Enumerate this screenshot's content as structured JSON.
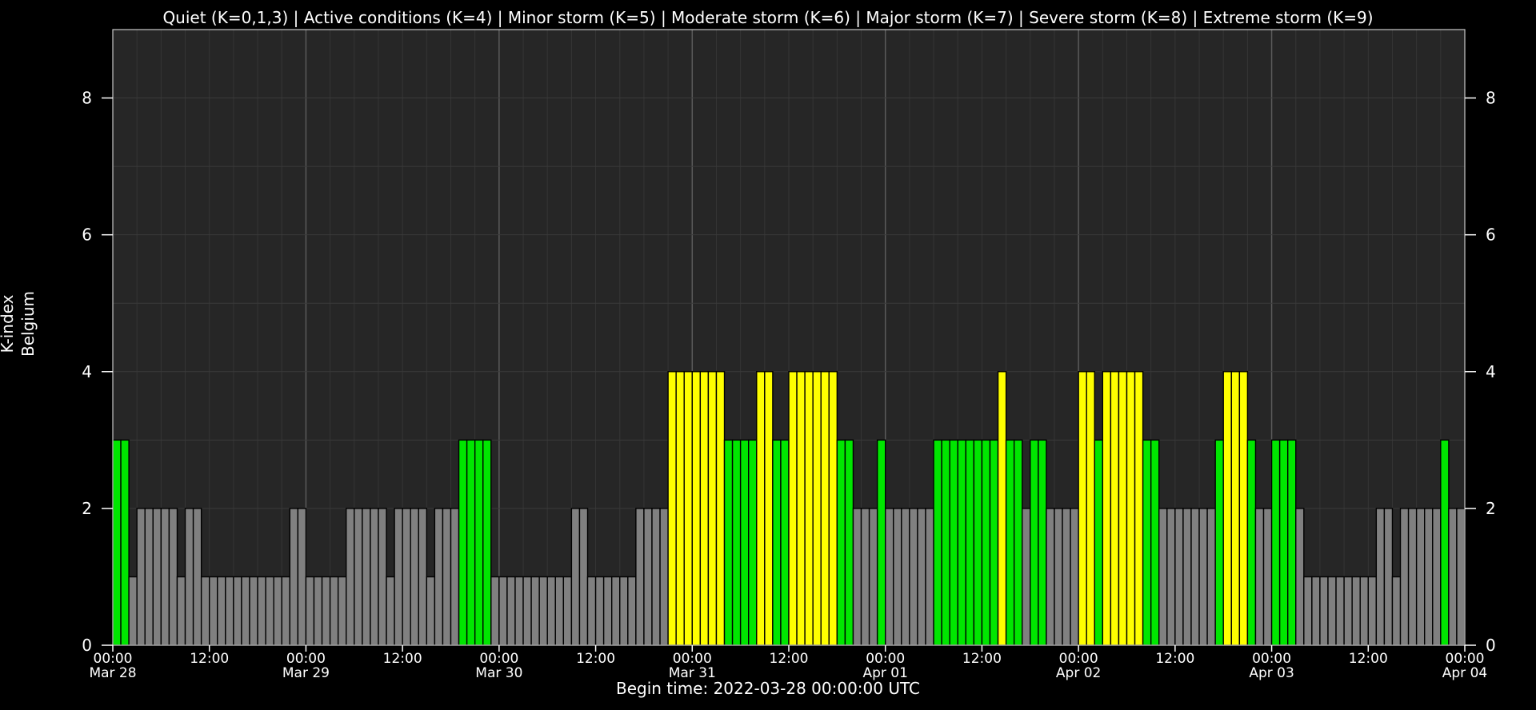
{
  "header": {
    "legend_line": "Quiet (K=0,1,3) | Active conditions (K=4) | Minor storm (K=5) | Moderate storm (K=6) | Major storm (K=7) | Severe storm (K=8) | Extreme storm (K=9)"
  },
  "footer": {
    "begin_time": "Begin time: 2022-03-28 00:00:00 UTC"
  },
  "colors": {
    "background": "#000000",
    "plot_area": "#262626",
    "k_0_2": "#808080",
    "k_3": "#00e600",
    "k_4": "#ffff00"
  },
  "chart_data": {
    "type": "bar",
    "ylabel_lines": [
      "K-index",
      "Belgium"
    ],
    "ylim": [
      0,
      9
    ],
    "yticks": [
      0,
      2,
      4,
      6,
      8
    ],
    "grid": true,
    "x_start": "2022-03-28 00:00",
    "x_end": "2022-04-04 00:00",
    "bar_interval_hours": 1,
    "xticks": [
      {
        "time": "00:00",
        "date": "Mar 28"
      },
      {
        "time": "12:00",
        "date": ""
      },
      {
        "time": "00:00",
        "date": "Mar 29"
      },
      {
        "time": "12:00",
        "date": ""
      },
      {
        "time": "00:00",
        "date": "Mar 30"
      },
      {
        "time": "12:00",
        "date": ""
      },
      {
        "time": "00:00",
        "date": "Mar 31"
      },
      {
        "time": "12:00",
        "date": ""
      },
      {
        "time": "00:00",
        "date": "Apr 01"
      },
      {
        "time": "12:00",
        "date": ""
      },
      {
        "time": "00:00",
        "date": "Apr 02"
      },
      {
        "time": "12:00",
        "date": ""
      },
      {
        "time": "00:00",
        "date": "Apr 03"
      },
      {
        "time": "12:00",
        "date": ""
      },
      {
        "time": "00:00",
        "date": "Apr 04"
      }
    ],
    "values": [
      3,
      3,
      1,
      2,
      2,
      2,
      2,
      2,
      1,
      2,
      2,
      1,
      1,
      1,
      1,
      1,
      1,
      1,
      1,
      1,
      1,
      1,
      2,
      2,
      1,
      1,
      1,
      1,
      1,
      2,
      2,
      2,
      2,
      2,
      1,
      2,
      2,
      2,
      2,
      1,
      2,
      2,
      2,
      3,
      3,
      3,
      3,
      1,
      1,
      1,
      1,
      1,
      1,
      1,
      1,
      1,
      1,
      2,
      2,
      1,
      1,
      1,
      1,
      1,
      1,
      2,
      2,
      2,
      2,
      4,
      4,
      4,
      4,
      4,
      4,
      4,
      3,
      3,
      3,
      3,
      4,
      4,
      3,
      3,
      4,
      4,
      4,
      4,
      4,
      4,
      3,
      3,
      2,
      2,
      2,
      3,
      2,
      2,
      2,
      2,
      2,
      2,
      3,
      3,
      3,
      3,
      3,
      3,
      3,
      3,
      4,
      3,
      3,
      2,
      3,
      3,
      2,
      2,
      2,
      2,
      4,
      4,
      3,
      4,
      4,
      4,
      4,
      4,
      3,
      3,
      2,
      2,
      2,
      2,
      2,
      2,
      2,
      3,
      4,
      4,
      4,
      3,
      2,
      2,
      3,
      3,
      3,
      2,
      1,
      1,
      1,
      1,
      1,
      1,
      1,
      1,
      1,
      2,
      2,
      1,
      2,
      2,
      2,
      2,
      2,
      3,
      2,
      2
    ]
  }
}
